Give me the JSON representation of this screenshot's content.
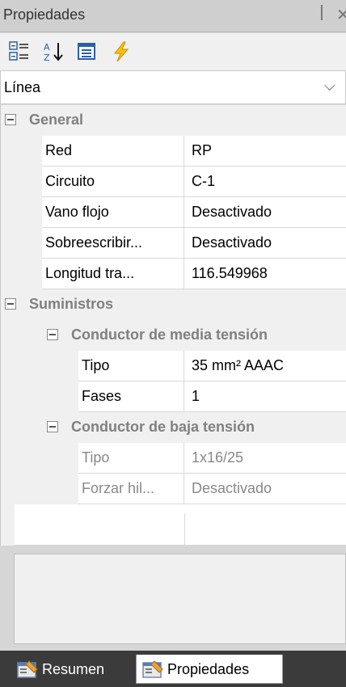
{
  "panel": {
    "title": "Propiedades",
    "pin_icon": "ꟾ",
    "close_icon": "✕"
  },
  "toolbar": {
    "buttons": [
      {
        "icon": "categorized-icon"
      },
      {
        "icon": "sort-alphabetical-icon"
      },
      {
        "icon": "property-pages-icon"
      },
      {
        "icon": "events-lightning-icon"
      }
    ]
  },
  "object_selector": {
    "value": "Línea",
    "chevron": "⌵"
  },
  "grid": {
    "general": {
      "label": "General",
      "props": [
        {
          "name": "Red",
          "value": "RP"
        },
        {
          "name": "Circuito",
          "value": "C-1"
        },
        {
          "name": "Vano flojo",
          "value": "Desactivado"
        },
        {
          "name": "Sobreescribir...",
          "value": "Desactivado"
        },
        {
          "name": "Longitud tra...",
          "value": "116.549968"
        }
      ]
    },
    "suministros": {
      "label": "Suministros",
      "media": {
        "label": "Conductor de media tensión",
        "props": [
          {
            "name": "Tipo",
            "value": "35 mm² AAAC"
          },
          {
            "name": "Fases",
            "value": "1"
          }
        ]
      },
      "baja": {
        "label": "Conductor de baja tensión",
        "props": [
          {
            "name": "Tipo",
            "value": "1x16/25"
          },
          {
            "name": "Forzar hil...",
            "value": "Desactivado"
          }
        ]
      }
    }
  },
  "tabs": [
    {
      "label": "Resumen",
      "active": false
    },
    {
      "label": "Propiedades",
      "active": true
    }
  ],
  "colors": {
    "titlebar": "#cfcfcf",
    "tabs_bg": "#3b3b3b",
    "category_text": "#808080"
  }
}
